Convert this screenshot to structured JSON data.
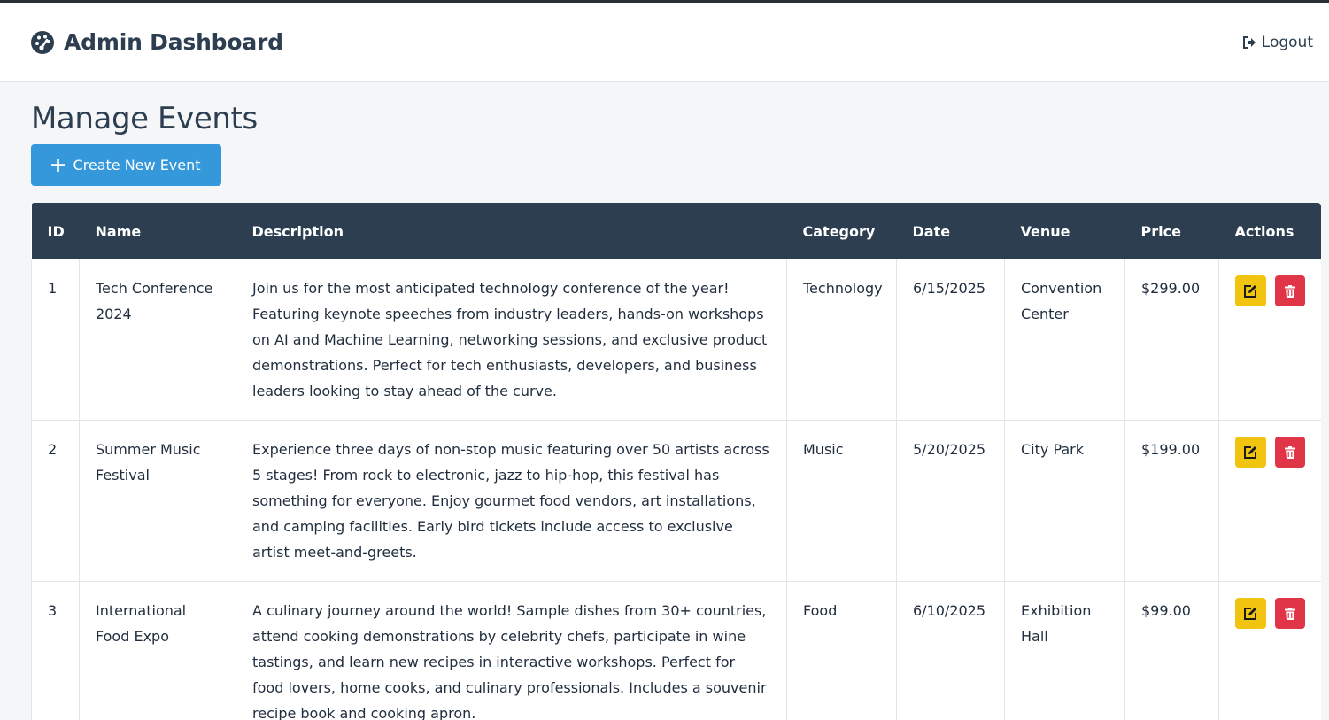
{
  "header": {
    "title": "Admin Dashboard",
    "logout_label": "Logout"
  },
  "main": {
    "page_title": "Manage Events",
    "create_button_label": "Create New Event"
  },
  "table": {
    "columns": [
      "ID",
      "Name",
      "Description",
      "Category",
      "Date",
      "Venue",
      "Price",
      "Actions"
    ],
    "rows": [
      {
        "id": "1",
        "name": "Tech Conference 2024",
        "description": "Join us for the most anticipated technology conference of the year! Featuring keynote speeches from industry leaders, hands-on workshops on AI and Machine Learning, networking sessions, and exclusive product demonstrations. Perfect for tech enthusiasts, developers, and business leaders looking to stay ahead of the curve.",
        "category": "Technology",
        "date": "6/15/2025",
        "venue": "Convention Center",
        "price": "$299.00"
      },
      {
        "id": "2",
        "name": "Summer Music Festival",
        "description": "Experience three days of non-stop music featuring over 50 artists across 5 stages! From rock to electronic, jazz to hip-hop, this festival has something for everyone. Enjoy gourmet food vendors, art installations, and camping facilities. Early bird tickets include access to exclusive artist meet-and-greets.",
        "category": "Music",
        "date": "5/20/2025",
        "venue": "City Park",
        "price": "$199.00"
      },
      {
        "id": "3",
        "name": "International Food Expo",
        "description": "A culinary journey around the world! Sample dishes from 30+ countries, attend cooking demonstrations by celebrity chefs, participate in wine tastings, and learn new recipes in interactive workshops. Perfect for food lovers, home cooks, and culinary professionals. Includes a souvenir recipe book and cooking apron.",
        "category": "Food",
        "date": "6/10/2025",
        "venue": "Exhibition Hall",
        "price": "$99.00"
      }
    ]
  },
  "icons": {
    "brand": "tachometer-icon",
    "logout": "sign-out-icon",
    "create": "plus-icon",
    "edit": "edit-icon",
    "delete": "trash-icon"
  },
  "colors": {
    "primary": "#3498db",
    "header_bg": "#2c3e50",
    "edit": "#f1c40f",
    "delete": "#e03546"
  }
}
